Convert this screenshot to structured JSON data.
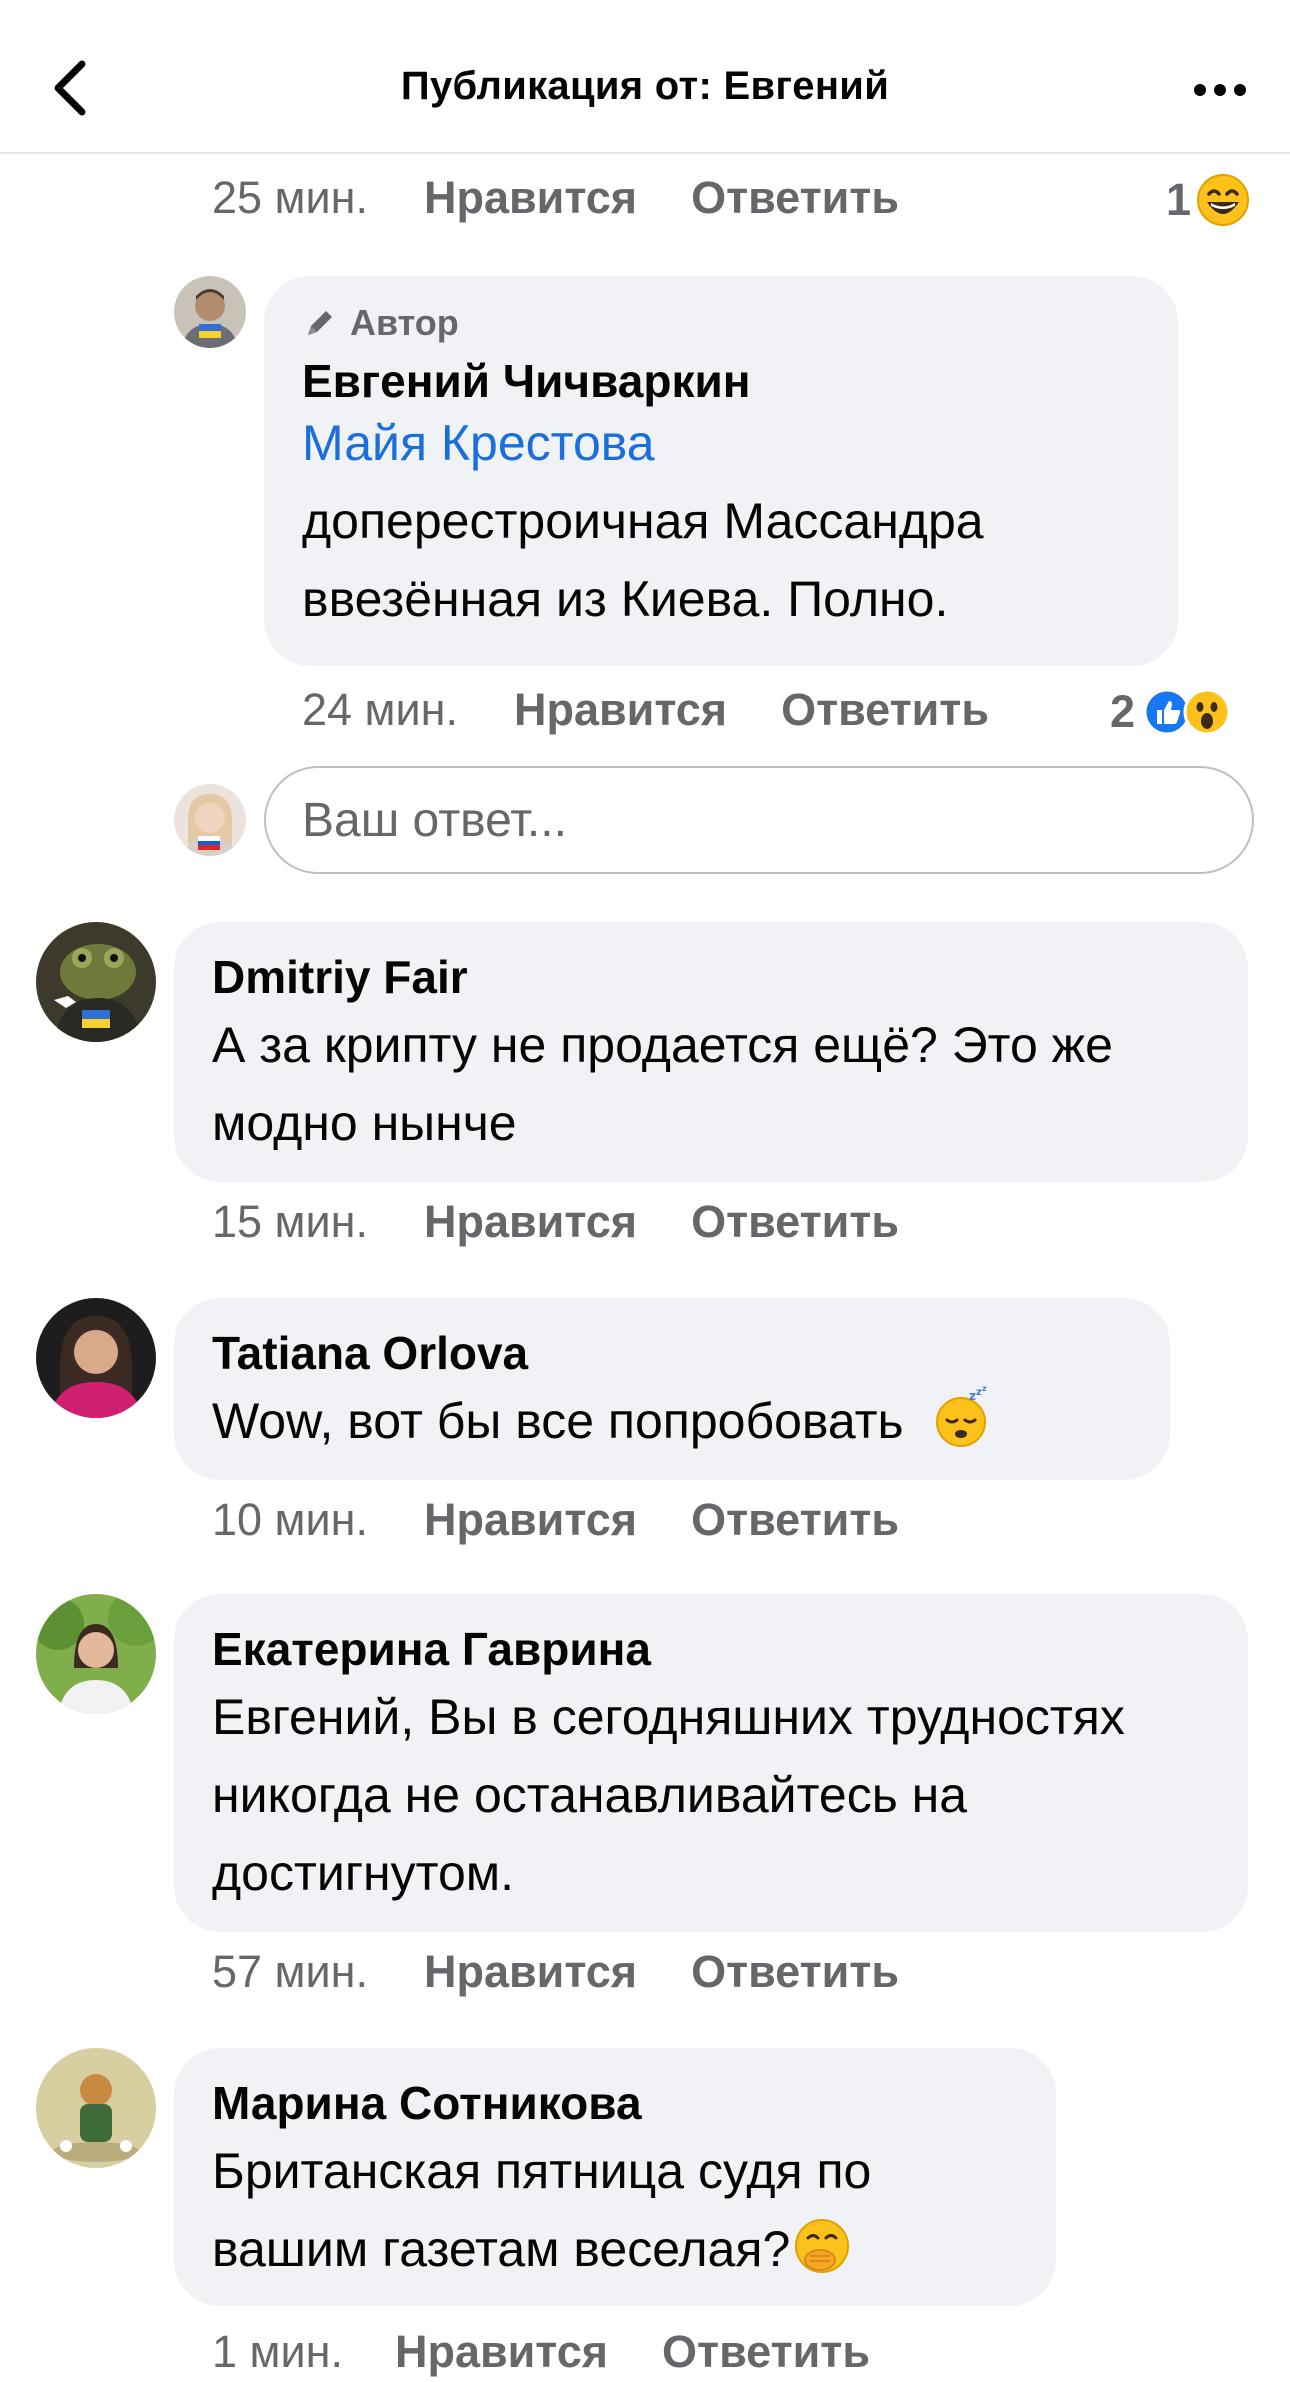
{
  "header": {
    "title": "Публикация от: Евгений"
  },
  "top_meta": {
    "time": "25 мин.",
    "like": "Нравится",
    "reply": "Ответить",
    "reactions": "1"
  },
  "nested_reply": {
    "badge": "Автор",
    "author": "Евгений Чичваркин",
    "mention": "Майя Крестова",
    "text": "доперестроичная Массандра ввезённая из Киева.  Полно.",
    "time": "24 мин.",
    "like": "Нравится",
    "reply": "Ответить",
    "reactions": "2"
  },
  "reply_box": {
    "placeholder": "Ваш ответ..."
  },
  "comments": [
    {
      "author": "Dmitriy Fair",
      "text": "А за крипту не продается ещё? Это же модно нынче",
      "time": "15 мин.",
      "like": "Нравится",
      "reply": "Ответить"
    },
    {
      "author": "Tatiana Orlova",
      "text": "Wow, вот бы все попробовать",
      "time": "10 мин.",
      "like": "Нравится",
      "reply": "Ответить"
    },
    {
      "author": "Екатерина Гаврина",
      "text": "Евгений, Вы в сегодняшних трудностях никогда не останавливайтесь на достигнутом.",
      "time": "57 мин.",
      "like": "Нравится",
      "reply": "Ответить"
    },
    {
      "author": "Марина Сотникова",
      "text": "Британская пятница судя по вашим газетам веселая?",
      "time": "1 мин.",
      "like": "Нравится",
      "reply": "Ответить"
    }
  ],
  "icons": {
    "back": "chevron-left-icon",
    "more": "more-dots-icon",
    "pencil": "pencil-icon",
    "laugh": "laugh-emoji-icon",
    "like": "like-reaction-icon",
    "wow": "wow-reaction-icon",
    "sleepy": "sleepy-emoji-icon",
    "hand_over_mouth": "hand-over-mouth-emoji-icon"
  },
  "colors": {
    "mention": "#1b6fdd",
    "meta": "#65676b",
    "bubble": "#f0f2f5",
    "like_blue": "#1877f2"
  }
}
